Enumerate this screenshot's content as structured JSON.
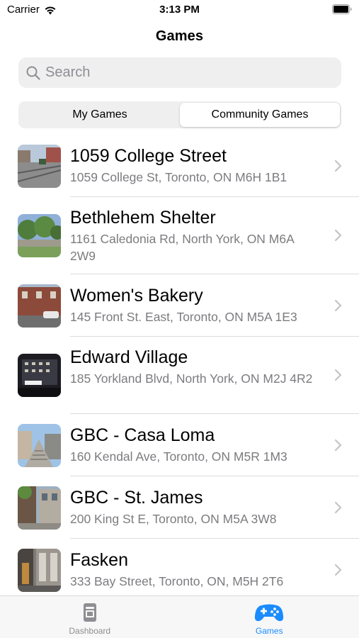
{
  "status_bar": {
    "carrier": "Carrier",
    "time": "3:13 PM"
  },
  "nav": {
    "title": "Games"
  },
  "search": {
    "placeholder": "Search",
    "value": ""
  },
  "segments": [
    {
      "label": "My Games",
      "selected": false
    },
    {
      "label": "Community Games",
      "selected": true
    }
  ],
  "games": [
    {
      "title": "1059 College Street",
      "address": "1059 College St, Toronto, ON M6H 1B1"
    },
    {
      "title": "Bethlehem Shelter",
      "address": "1161 Caledonia Rd, North York, ON M6A 2W9"
    },
    {
      "title": "Women's Bakery",
      "address": "145 Front St. East, Toronto, ON M5A 1E3"
    },
    {
      "title": "Edward Village",
      "address": "185 Yorkland Blvd, North York, ON M2J 4R2"
    },
    {
      "title": "GBC - Casa Loma",
      "address": "160 Kendal Ave, Toronto, ON M5R 1M3"
    },
    {
      "title": "GBC - St. James",
      "address": "200 King St E, Toronto, ON M5A 3W8"
    },
    {
      "title": "Fasken",
      "address": "333 Bay Street, Toronto, ON, M5H 2T6"
    }
  ],
  "tab_bar": {
    "tabs": [
      {
        "label": "Dashboard",
        "icon": "dashboard-icon",
        "active": false
      },
      {
        "label": "Games",
        "icon": "gamepad-icon",
        "active": true
      }
    ]
  },
  "colors": {
    "accent": "#1a8cff",
    "secondary_text": "#7c7c80",
    "inactive_tab": "#8e8e93"
  }
}
